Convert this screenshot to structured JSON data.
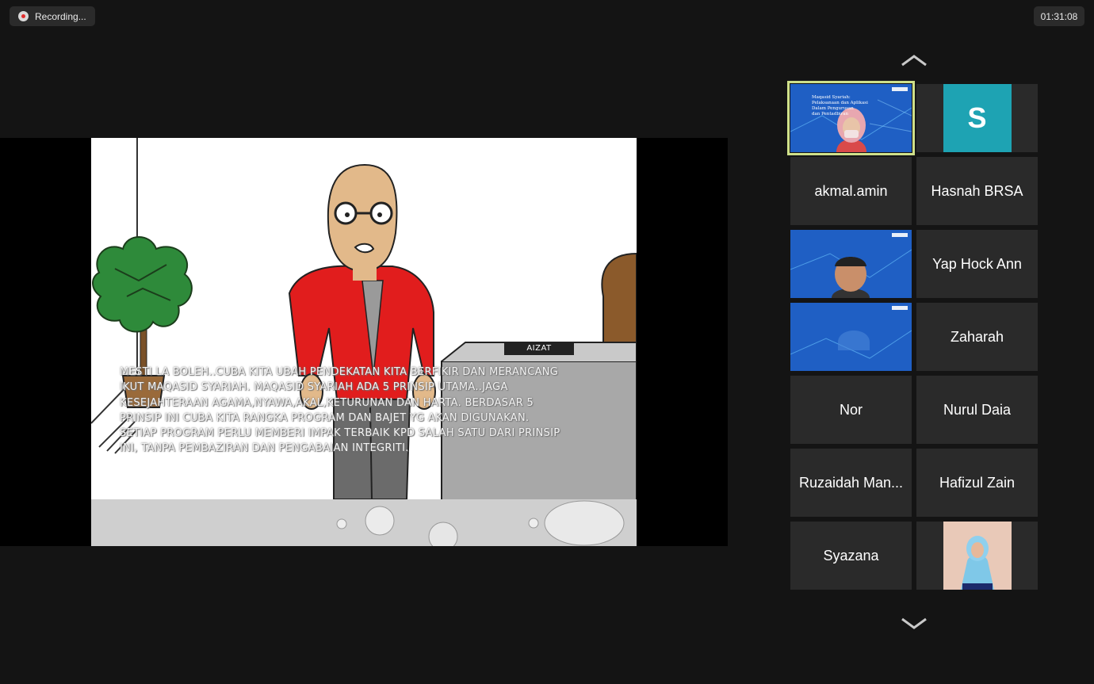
{
  "recording": {
    "label": "Recording...",
    "elapsed": "01:31:08"
  },
  "share": {
    "nameplate": "AIZAT",
    "caption": "MESTI LA BOLEH..CUBA KITA UBAH PENDEKATAN KITA BERFIKIR DAN MERANCANG IKUT MAQASID SYARIAH. MAQASID SYARIAH ADA 5 PRINSIP UTAMA..JAGA KESEJAHTERAAN AGAMA,NYAWA,AKAL,KETURUNAN DAN HARTA. BERDASAR 5 PRINSIP INI CUBA KITA RANGKA  PROGRAM DAN BAJET YG AKAN DIGUNAKAN. SETIAP PROGRAM PERLU MEMBERI IMPAK TERBAIK KPD SALAH SATU DARI PRINSIP INI, TANPA PEMBAZIRAN DAN PENGABAIAN INTEGRITI.",
    "slide_title_lines": [
      "Maqasid Syariah:",
      "Pelaksanaan dan Aplikasi",
      "Dalam Pengurusan",
      "dan Pentadbiran"
    ]
  },
  "gallery": {
    "avatar_initial": "S",
    "names": {
      "akmal": "akmal.amin",
      "hasnah": "Hasnah BRSA",
      "yap": "Yap Hock Ann",
      "zaharah": "Zaharah",
      "nor": "Nor",
      "nurul": "Nurul Daia",
      "ruzaidah": "Ruzaidah Man...",
      "hafizul": "Hafizul Zain",
      "syazana": "Syazana"
    }
  },
  "colors": {
    "active_speaker_border": "#cfe08a",
    "avatar_bg": "#1ea3b3",
    "tile_bg": "#2a2a2a",
    "recording_dot": "#e02b2b"
  }
}
